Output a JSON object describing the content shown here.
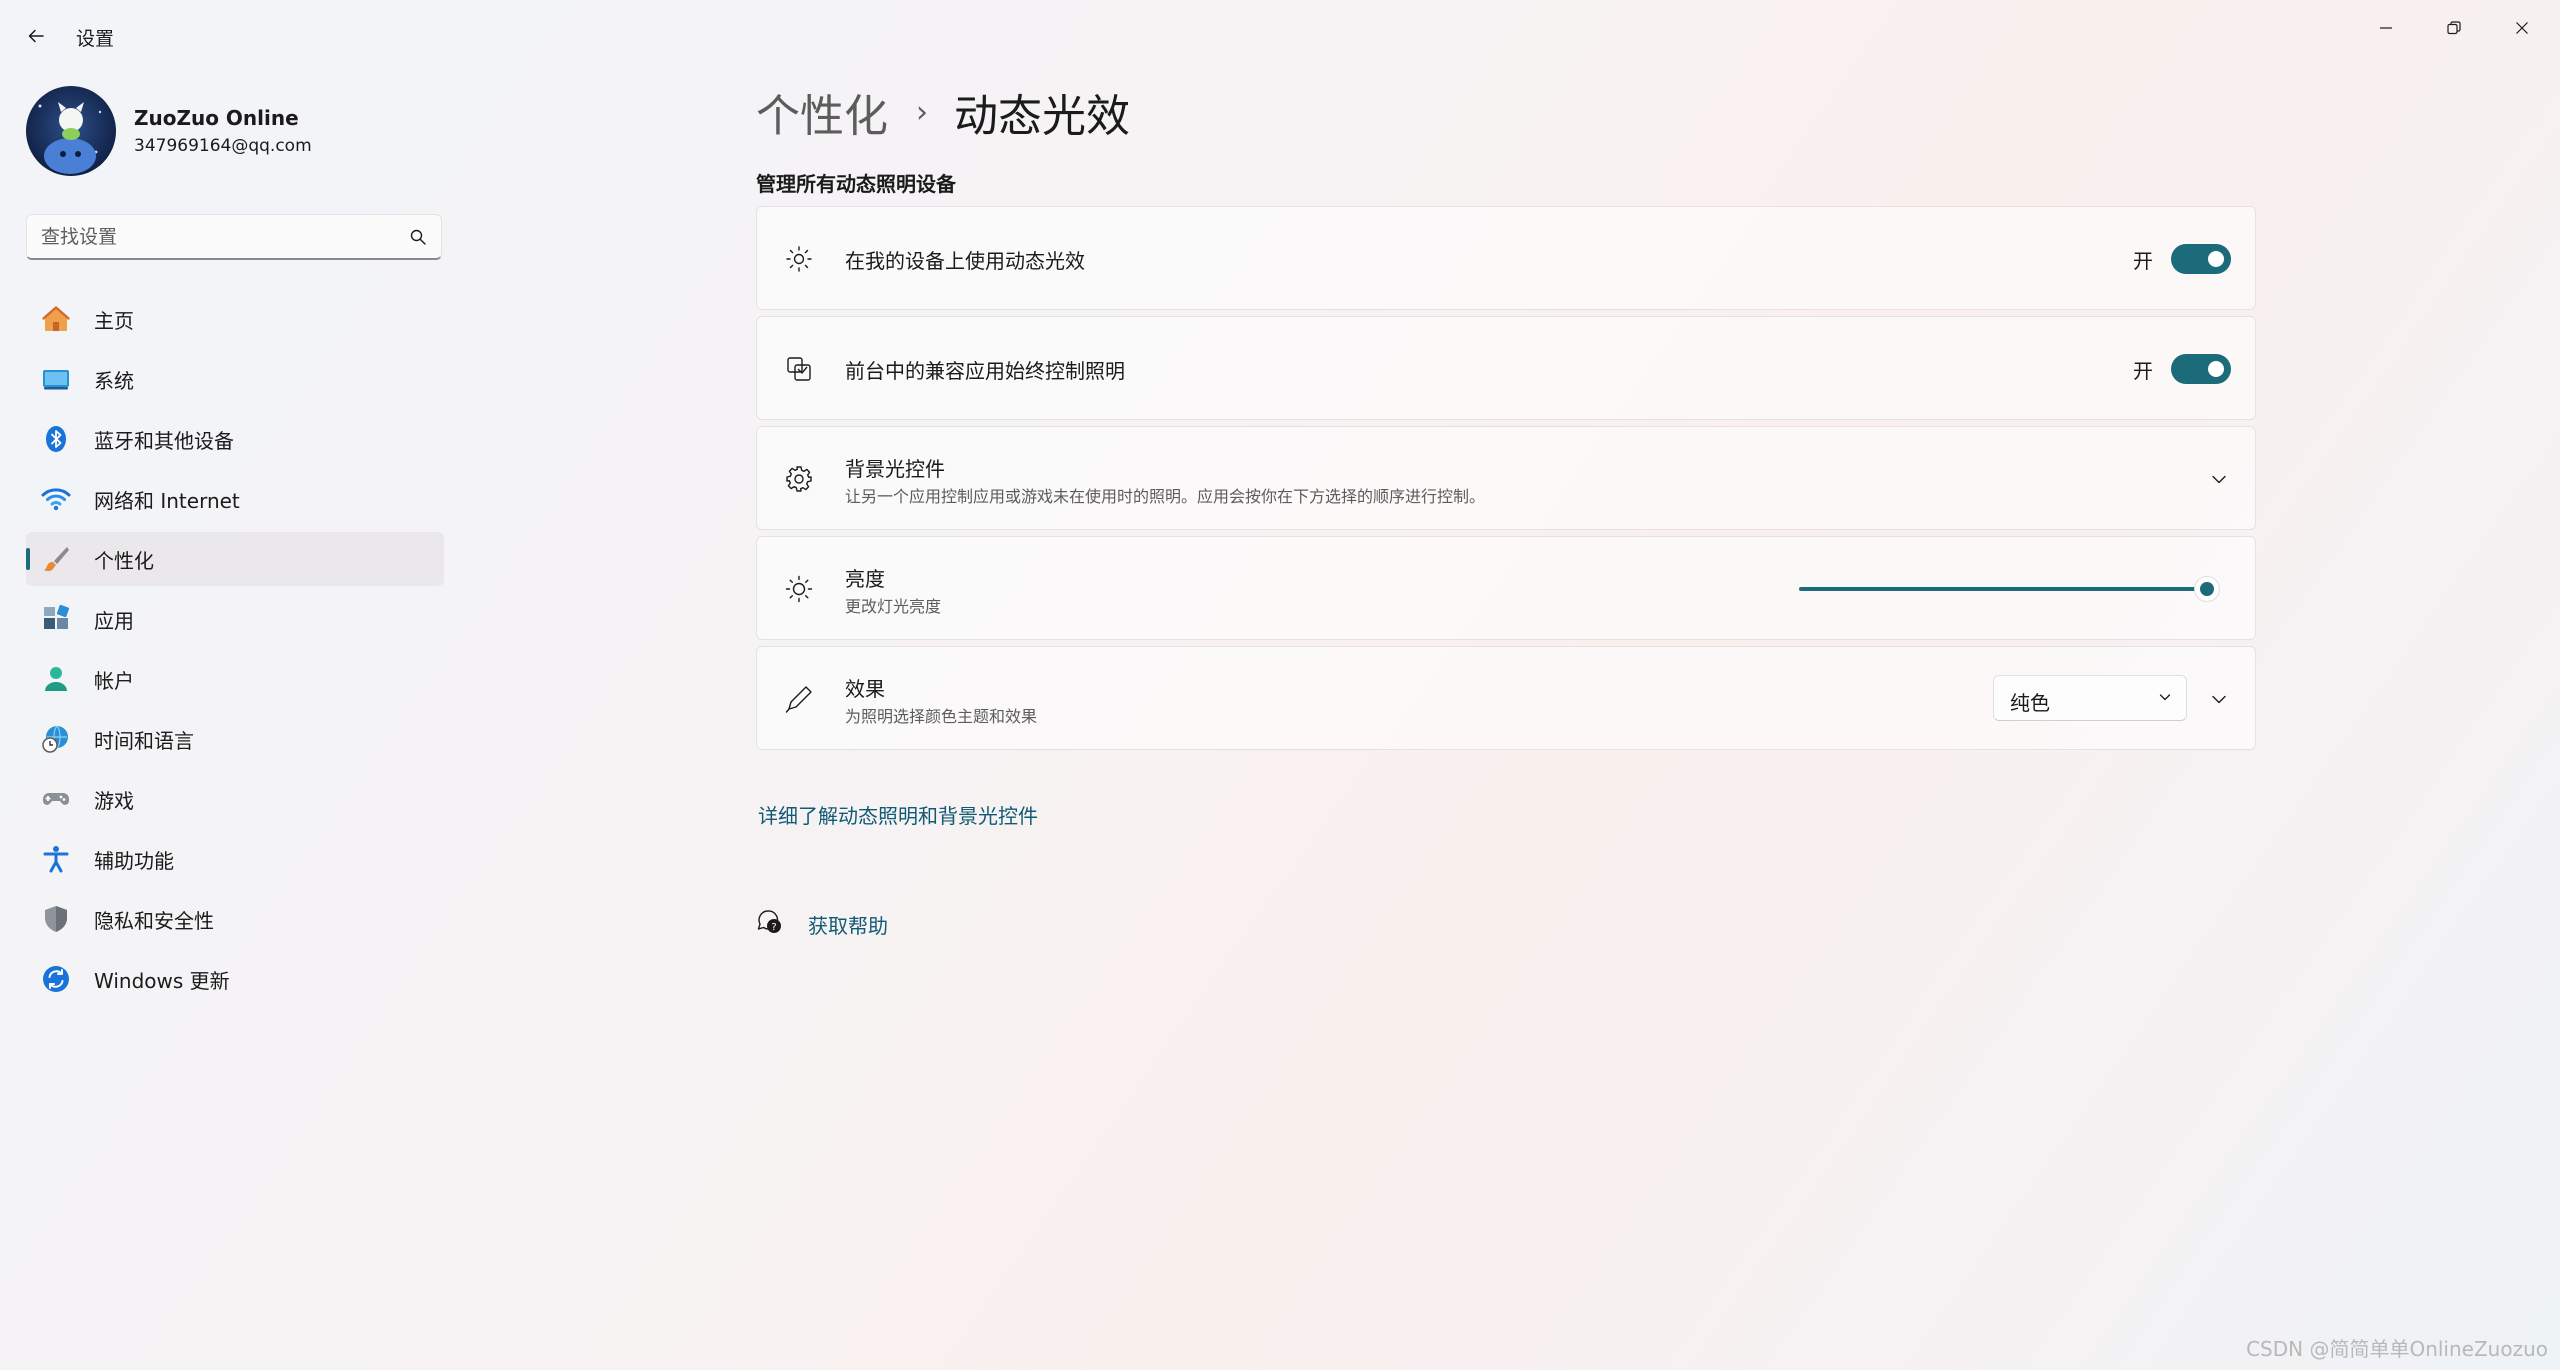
{
  "window": {
    "title": "设置",
    "back_icon": "arrow-left-icon",
    "minimize_icon": "minimize-icon",
    "maximize_icon": "restore-icon",
    "close_icon": "close-icon"
  },
  "profile": {
    "name": "ZuoZuo Online",
    "email": "347969164@qq.com"
  },
  "search": {
    "placeholder": "查找设置",
    "value": ""
  },
  "sidebar": {
    "items": [
      {
        "label": "主页",
        "icon": "home-icon"
      },
      {
        "label": "系统",
        "icon": "system-icon"
      },
      {
        "label": "蓝牙和其他设备",
        "icon": "bluetooth-icon"
      },
      {
        "label": "网络和 Internet",
        "icon": "wifi-icon"
      },
      {
        "label": "个性化",
        "icon": "brush-icon",
        "active": true
      },
      {
        "label": "应用",
        "icon": "apps-icon"
      },
      {
        "label": "帐户",
        "icon": "account-icon"
      },
      {
        "label": "时间和语言",
        "icon": "globe-clock-icon"
      },
      {
        "label": "游戏",
        "icon": "gamepad-icon"
      },
      {
        "label": "辅助功能",
        "icon": "accessibility-icon"
      },
      {
        "label": "隐私和安全性",
        "icon": "shield-icon"
      },
      {
        "label": "Windows 更新",
        "icon": "update-icon"
      }
    ]
  },
  "breadcrumb": {
    "parent": "个性化",
    "separator": "›",
    "current": "动态光效"
  },
  "main": {
    "section_title": "管理所有动态照明设备",
    "cards": {
      "use_dynamic": {
        "title": "在我的设备上使用动态光效",
        "toggle_label": "开",
        "toggle_on": true,
        "icon": "dynamic-lighting-icon"
      },
      "compatible_apps": {
        "title": "前台中的兼容应用始终控制照明",
        "toggle_label": "开",
        "toggle_on": true,
        "icon": "app-lighting-icon"
      },
      "ambient": {
        "title": "背景光控件",
        "description": "让另一个应用控制应用或游戏未在使用时的照明。应用会按你在下方选择的顺序进行控制。",
        "icon": "gear-icon"
      },
      "brightness": {
        "title": "亮度",
        "description": "更改灯光亮度",
        "value_percent": 100,
        "icon": "brightness-icon"
      },
      "effects": {
        "title": "效果",
        "description": "为照明选择颜色主题和效果",
        "dropdown_value": "纯色",
        "icon": "pen-icon"
      }
    },
    "learn_more_link": "详细了解动态照明和背景光控件",
    "help_label": "获取帮助",
    "help_icon": "help-icon"
  },
  "watermark": "CSDN @简简单单OnlineZuozuo",
  "colors": {
    "accent": "#1b6b7a",
    "link": "#115a74"
  }
}
